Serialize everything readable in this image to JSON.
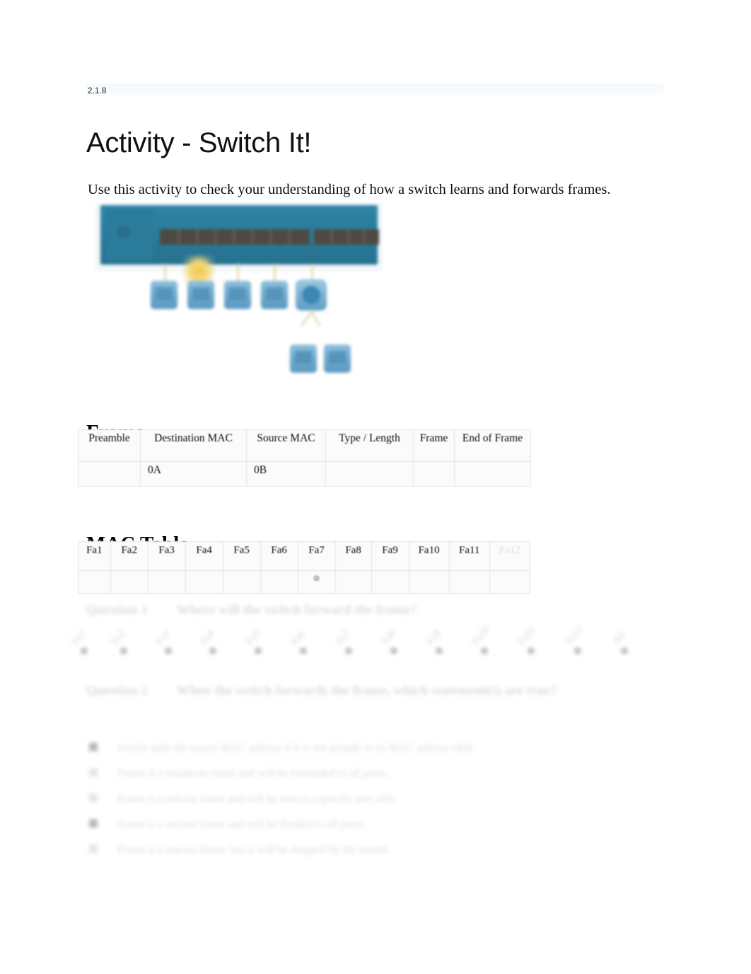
{
  "document": {
    "section_number": "2.1.8",
    "title": "Activity - Switch It!",
    "intro": "Use this activity to check your understanding of how a switch learns and forwards frames."
  },
  "figure": {
    "name": "switch-topology-diagram",
    "switch_color": "#2a7c9c",
    "host_color": "#6ba7cb",
    "cable_color": "#e6d9b4",
    "highlight_color": "#f1c84b"
  },
  "frame_section": {
    "heading": "Frame",
    "headers": [
      "Preamble",
      "Destination MAC",
      "Source MAC",
      "Type / Length",
      "Frame",
      "End of Frame"
    ],
    "values": [
      "",
      "0A",
      "0B",
      "",
      "",
      ""
    ]
  },
  "mac_section": {
    "heading": "MAC Table",
    "headers": [
      "Fa1",
      "Fa2",
      "Fa3",
      "Fa4",
      "Fa5",
      "Fa6",
      "Fa7",
      "Fa8",
      "Fa9",
      "Fa10",
      "Fa11",
      "Fa12"
    ],
    "row": [
      "",
      "",
      "",
      "",
      "",
      "",
      "●",
      "",
      "",
      "",
      "",
      ""
    ]
  },
  "question1": {
    "label": "Question 1",
    "text": "Where will the switch forward the frame?",
    "choices": [
      "Fa1",
      "Fa2",
      "Fa3",
      "Fa4",
      "Fa5",
      "Fa6",
      "Fa7",
      "Fa8",
      "Fa9",
      "Fa10",
      "Fa11",
      "Fa12",
      "All"
    ]
  },
  "question2": {
    "label": "Question 2",
    "text": "When the switch forwards the frame, which statement(s) are true?",
    "options": [
      {
        "text": "Switch adds the source MAC address if it is not already in its MAC address table.",
        "checked": true
      },
      {
        "text": "Frame is a broadcast frame and will be forwarded to all ports.",
        "checked": false
      },
      {
        "text": "Frame is a unicast frame and will be sent to a specific port only.",
        "checked": false
      },
      {
        "text": "Frame is a unicast frame and will be flooded to all ports.",
        "checked": true
      },
      {
        "text": "Frame is a unicast frame, but is will be dropped by the switch.",
        "checked": false
      }
    ]
  }
}
